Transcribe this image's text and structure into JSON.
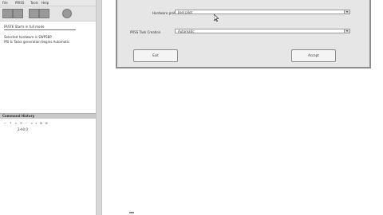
{
  "menubar": {
    "items": [
      "File",
      "PRISS",
      "Tools",
      "Help"
    ]
  },
  "toolbar": {
    "buttons": [
      "toolbar-button-1",
      "toolbar-button-2",
      "toolbar-button-3",
      "toolbar-button-4",
      "toolbar-button-5"
    ]
  },
  "console": {
    "lines": [
      "PASTE Starts in full mode",
      "Selected hardware is SWPSBP",
      "PRI & Tasks generation begins Automatic"
    ]
  },
  "history": {
    "title": "Command History",
    "tools": "⌐ ↑ ↓ ✕ ⋯  ⌕ ⌕ ⊞ ⊞",
    "entries": [
      "2-h0.0"
    ]
  },
  "dialog": {
    "hardware_label": "Hardware profile",
    "hardware_value": "Jisel pilot",
    "task_label": "PRSS Task Creation",
    "task_value": "Automatic",
    "exit_label": "Exit",
    "accept_label": "Accept"
  },
  "colors": {
    "window_bg": "#e6e6e6",
    "panel_bg": "#ffffff",
    "splitter": "#d8d8d8"
  }
}
